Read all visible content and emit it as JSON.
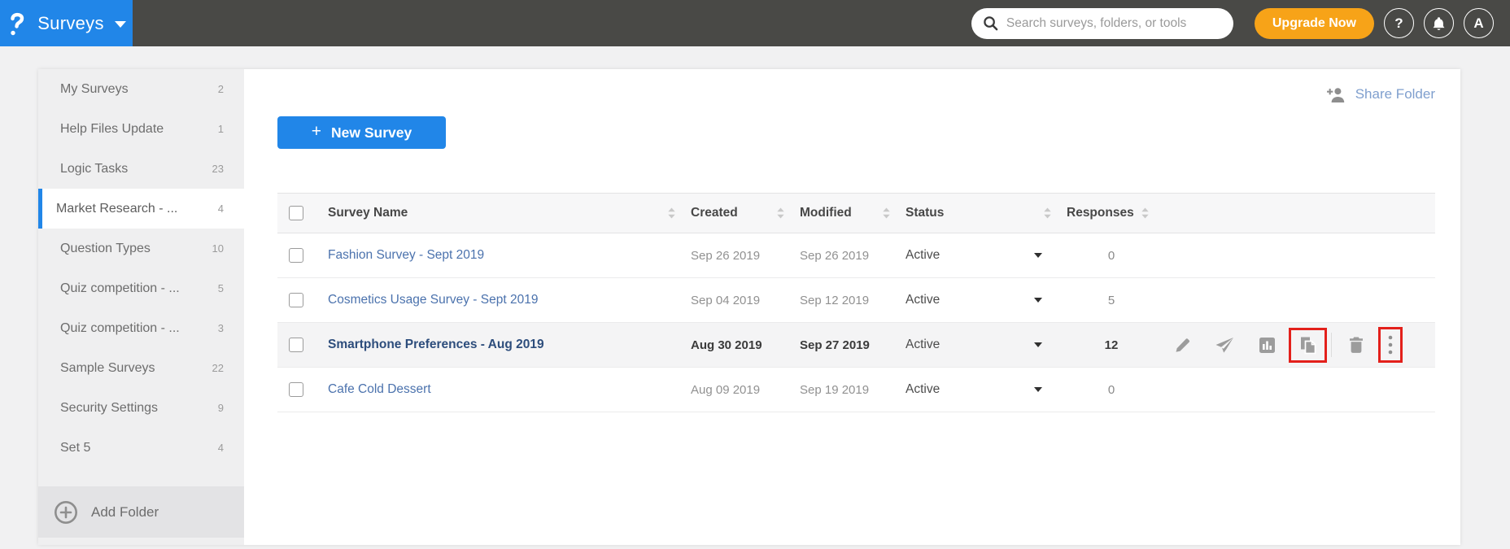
{
  "topbar": {
    "app_name": "Surveys",
    "search_placeholder": "Search surveys, folders, or tools",
    "upgrade_label": "Upgrade Now",
    "help_label": "?",
    "avatar_label": "A"
  },
  "sidebar": {
    "items": [
      {
        "label": "My Surveys",
        "count": "2",
        "active": false
      },
      {
        "label": "Help Files Update",
        "count": "1",
        "active": false
      },
      {
        "label": "Logic Tasks",
        "count": "23",
        "active": false
      },
      {
        "label": "Market Research - ...",
        "count": "4",
        "active": true
      },
      {
        "label": "Question Types",
        "count": "10",
        "active": false
      },
      {
        "label": "Quiz competition - ...",
        "count": "5",
        "active": false
      },
      {
        "label": "Quiz competition - ...",
        "count": "3",
        "active": false
      },
      {
        "label": "Sample Surveys",
        "count": "22",
        "active": false
      },
      {
        "label": "Security Settings",
        "count": "9",
        "active": false
      },
      {
        "label": "Set 5",
        "count": "4",
        "active": false
      }
    ],
    "add_folder_label": "Add Folder"
  },
  "main": {
    "share_folder_label": "Share Folder",
    "new_survey_label": "New Survey",
    "new_survey_plus": "+",
    "table": {
      "headers": {
        "name": "Survey Name",
        "created": "Created",
        "modified": "Modified",
        "status": "Status",
        "responses": "Responses"
      },
      "rows": [
        {
          "name": "Fashion Survey - Sept 2019",
          "created": "Sep 26 2019",
          "modified": "Sep 26 2019",
          "status": "Active",
          "responses": "0",
          "highlighted": false
        },
        {
          "name": "Cosmetics Usage Survey - Sept 2019",
          "created": "Sep 04 2019",
          "modified": "Sep 12 2019",
          "status": "Active",
          "responses": "5",
          "highlighted": false
        },
        {
          "name": "Smartphone Preferences - Aug 2019",
          "created": "Aug 30 2019",
          "modified": "Sep 27 2019",
          "status": "Active",
          "responses": "12",
          "highlighted": true
        },
        {
          "name": "Cafe Cold Dessert",
          "created": "Aug 09 2019",
          "modified": "Sep 19 2019",
          "status": "Active",
          "responses": "0",
          "highlighted": false
        }
      ]
    }
  },
  "colors": {
    "brand_blue": "#2186e8",
    "topbar_gray": "#494946",
    "upgrade_orange": "#f7a318",
    "annotation_red": "#e3201b",
    "link_blue": "#4b72ad"
  }
}
